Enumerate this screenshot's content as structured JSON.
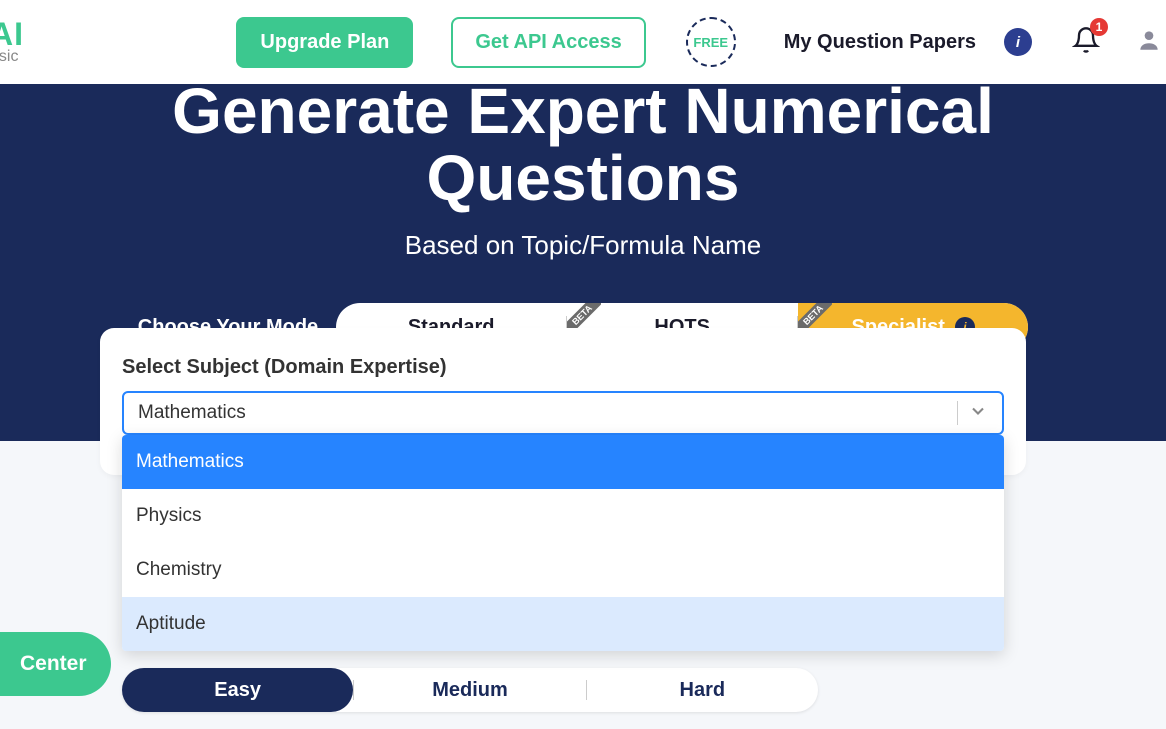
{
  "header": {
    "logo_text": "AI",
    "logo_sub": "asic",
    "upgrade_label": "Upgrade Plan",
    "api_label": "Get API Access",
    "free_text": "FREE",
    "my_papers": "My Question Papers",
    "notification_count": "1"
  },
  "hero": {
    "title_line1": "Generate Expert Numerical",
    "title_line2": "Questions",
    "subtitle": "Based on Topic/Formula Name"
  },
  "modes": {
    "label": "Choose Your Mode",
    "items": [
      {
        "label": "Standard",
        "beta": false,
        "active": false
      },
      {
        "label": "HOTS",
        "beta": true,
        "active": false
      },
      {
        "label": "Specialist",
        "beta": true,
        "active": true
      }
    ]
  },
  "form": {
    "subject_label": "Select Subject (Domain Expertise)",
    "subject_value": "Mathematics",
    "subject_options": [
      {
        "label": "Mathematics",
        "state": "selected"
      },
      {
        "label": "Physics",
        "state": ""
      },
      {
        "label": "Chemistry",
        "state": ""
      },
      {
        "label": "Aptitude",
        "state": "hover"
      }
    ]
  },
  "difficulty": {
    "items": [
      {
        "label": "Easy",
        "active": true
      },
      {
        "label": "Medium",
        "active": false
      },
      {
        "label": "Hard",
        "active": false
      }
    ]
  },
  "help_center": "Center"
}
